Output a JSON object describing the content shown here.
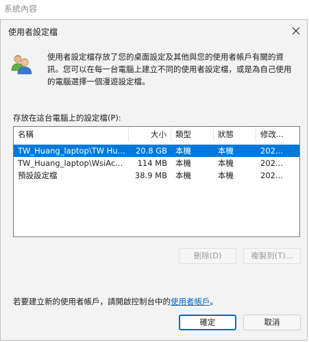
{
  "background_window": {
    "title": "系統內容"
  },
  "dialog": {
    "title": "使用者設定檔",
    "description": "使用者設定檔存放了您的桌面設定及其他與您的使用者帳戶有關的資訊。您可以在每一台電腦上建立不同的使用者設定檔，或是為自己使用的電腦選擇一個漫遊設定檔。",
    "list_label": "存放在這台電腦上的設定檔(P):",
    "columns": [
      "名稱",
      "大小",
      "類型",
      "狀態",
      "修改..."
    ],
    "rows": [
      {
        "name": "TW_Huang_laptop\\TW Hu...",
        "size": "20.8 GB",
        "type": "本機",
        "status": "本機",
        "modified": "202...",
        "selected": true
      },
      {
        "name": "TW_Huang_laptop\\WsiAc...",
        "size": "114 MB",
        "type": "本機",
        "status": "本機",
        "modified": "202...",
        "selected": false
      },
      {
        "name": "預設設定檔",
        "size": "38.9 MB",
        "type": "本機",
        "status": "本機",
        "modified": "202...",
        "selected": false
      }
    ],
    "buttons": {
      "delete": "刪除(D)",
      "copy_to": "複製到(T)...",
      "ok": "確定",
      "cancel": "取消"
    },
    "create_text": "若要建立新的使用者帳戶，請開啟控制台中的",
    "create_link": "使用者帳戶",
    "create_suffix": "。"
  },
  "colors": {
    "selection": "#0078d7",
    "link": "#0067c0",
    "primary_border": "#0067c0",
    "dialog_bg": "#f3f3f3"
  },
  "icons": {
    "close": "close-icon",
    "users": "users-icon"
  }
}
